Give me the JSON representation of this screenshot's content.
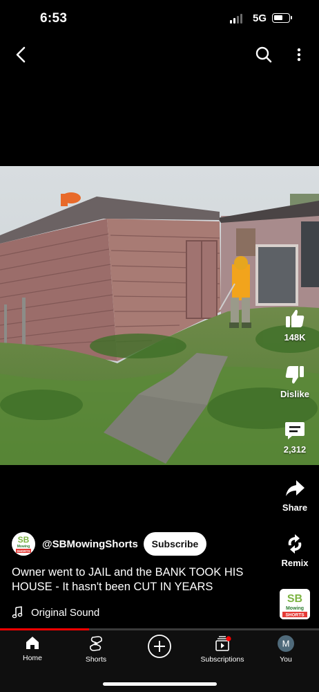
{
  "status_bar": {
    "time": "6:53",
    "network": "5G",
    "signal_bars": 2,
    "battery_level": 0.45
  },
  "top_nav": {
    "back_icon": "chevron-left-icon",
    "search_icon": "search-icon",
    "more_icon": "more-vertical-icon"
  },
  "actions": {
    "like": {
      "label": "148K",
      "icon": "thumbs-up-icon"
    },
    "dislike": {
      "label": "Dislike",
      "icon": "thumbs-down-icon"
    },
    "comments": {
      "label": "2,312",
      "icon": "comment-icon"
    },
    "share": {
      "label": "Share",
      "icon": "share-icon"
    },
    "remix": {
      "label": "Remix",
      "icon": "remix-icon"
    }
  },
  "channel": {
    "handle": "@SBMowingShorts",
    "logo_text": {
      "initials": "SB",
      "line1": "Mowing",
      "line2": "SHORTS"
    },
    "subscribe_label": "Subscribe"
  },
  "video": {
    "caption": "Owner went to JAIL and the BANK TOOK HIS HOUSE - It hasn't been CUT IN YEARS",
    "sound_label": "Original Sound",
    "progress": 0.28
  },
  "bottom_nav": [
    {
      "label": "Home",
      "icon": "home-icon"
    },
    {
      "label": "Shorts",
      "icon": "shorts-icon"
    },
    {
      "label": "",
      "icon": "create-icon"
    },
    {
      "label": "Subscriptions",
      "icon": "subscriptions-icon"
    },
    {
      "label": "You",
      "icon": "avatar",
      "initial": "M"
    }
  ],
  "colors": {
    "accent": "#ff0000",
    "background": "#000000",
    "logo_green": "#7cb342",
    "logo_red": "#e53935"
  }
}
